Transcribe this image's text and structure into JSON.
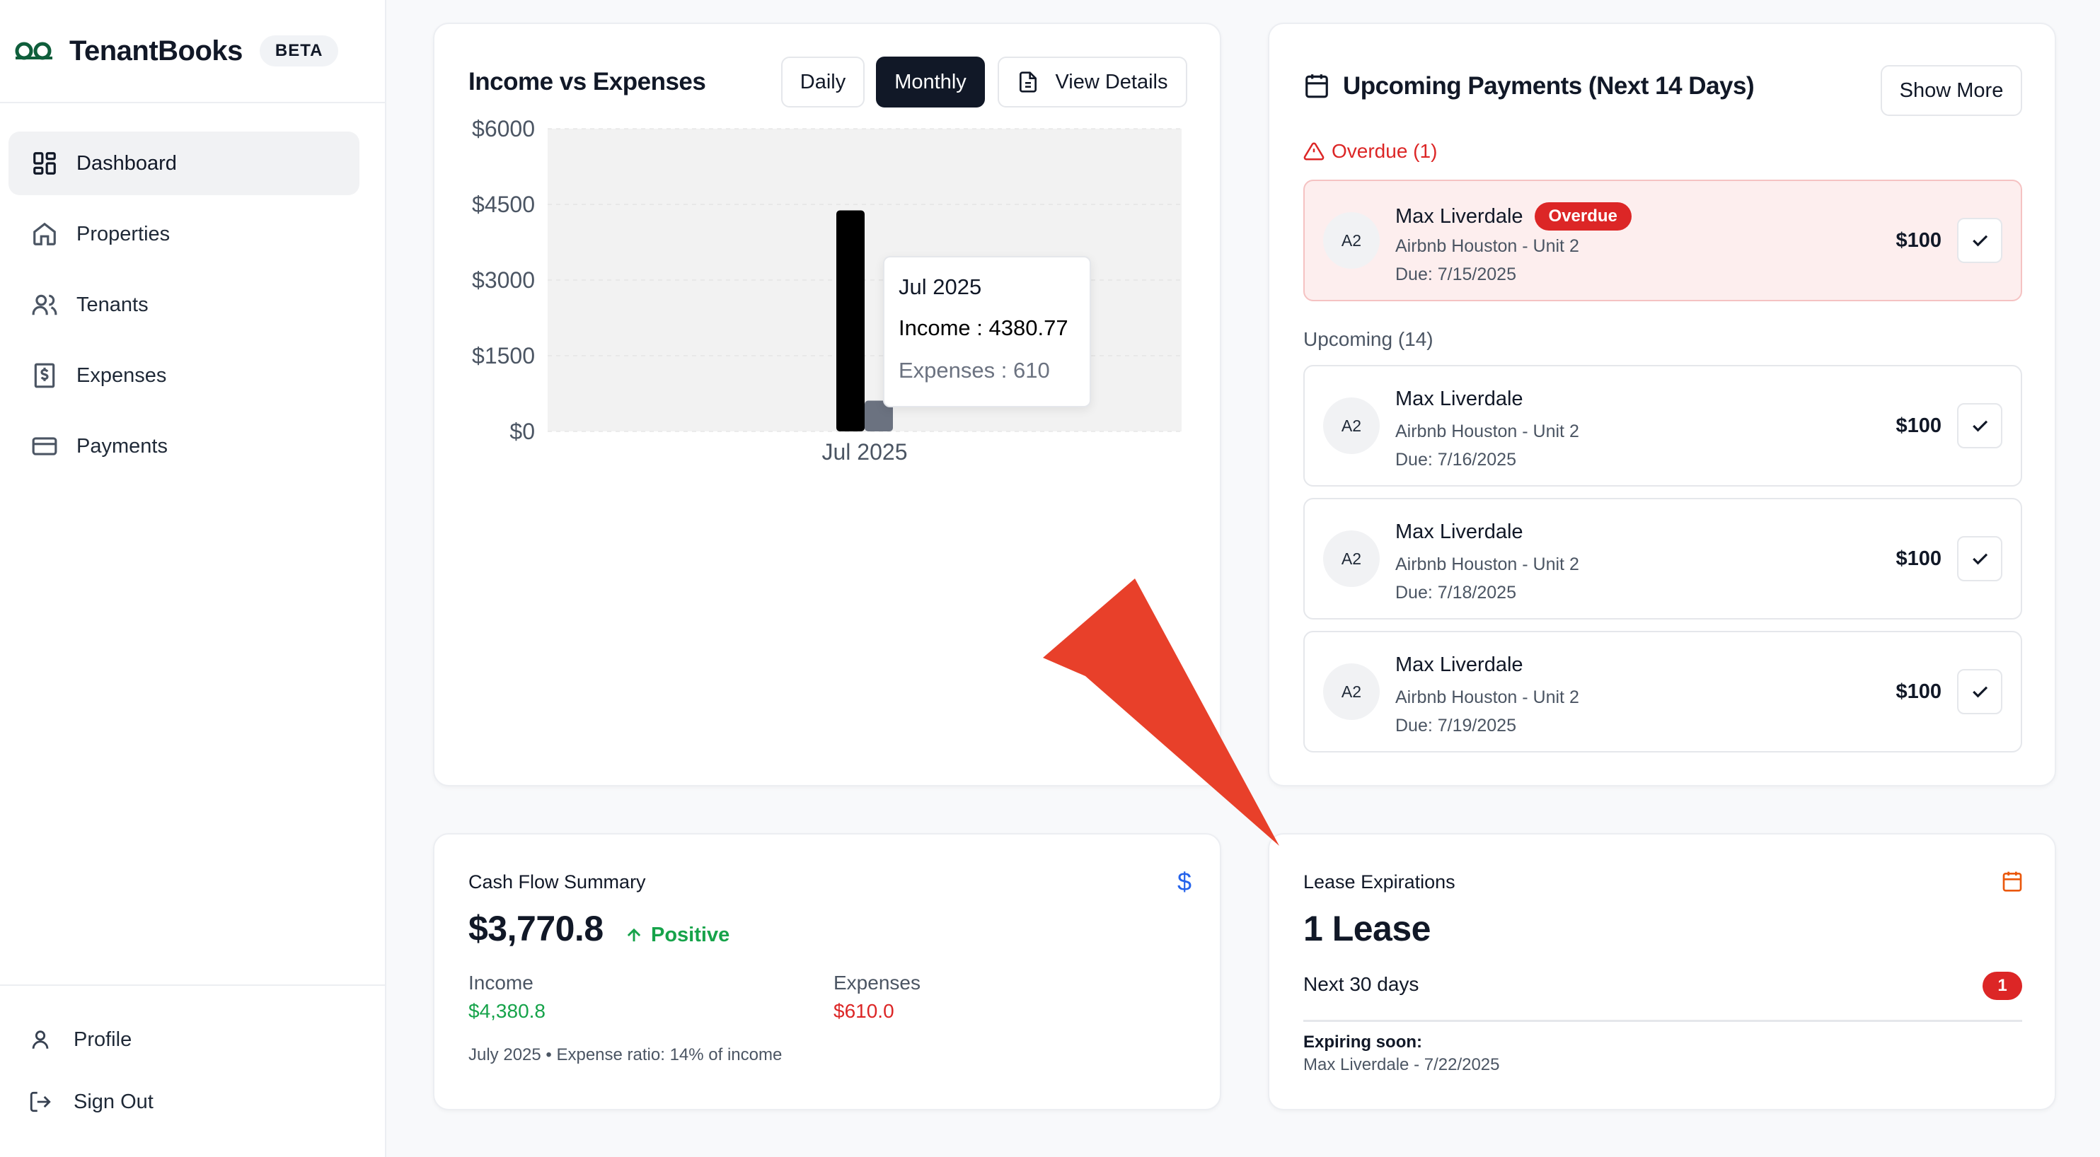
{
  "brand": {
    "name": "TenantBooks",
    "badge": "BETA"
  },
  "sidebar": {
    "items": [
      {
        "label": "Dashboard",
        "icon": "dashboard-icon",
        "active": true
      },
      {
        "label": "Properties",
        "icon": "home-icon"
      },
      {
        "label": "Tenants",
        "icon": "users-icon"
      },
      {
        "label": "Expenses",
        "icon": "receipt-icon"
      },
      {
        "label": "Payments",
        "icon": "credit-card-icon"
      }
    ],
    "bottom": [
      {
        "label": "Profile",
        "icon": "user-icon"
      },
      {
        "label": "Sign Out",
        "icon": "sign-out-icon"
      }
    ]
  },
  "income_card": {
    "title": "Income vs Expenses",
    "buttons": {
      "daily": "Daily",
      "monthly": "Monthly",
      "details": "View Details"
    },
    "tooltip": {
      "title": "Jul 2025",
      "income": "Income : 4380.77",
      "expenses": "Expenses : 610"
    }
  },
  "chart_data": {
    "type": "bar",
    "categories": [
      "Jul 2025"
    ],
    "series": [
      {
        "name": "Income",
        "values": [
          4380.77
        ],
        "color": "#000000"
      },
      {
        "name": "Expenses",
        "values": [
          610
        ],
        "color": "#6b7280"
      }
    ],
    "y_ticks": [
      "$0",
      "$1500",
      "$3000",
      "$4500",
      "$6000"
    ],
    "ylim": [
      0,
      6000
    ],
    "grid": true
  },
  "payments_card": {
    "title": "Upcoming Payments (Next 14 Days)",
    "show_more": "Show More",
    "overdue_label": "Overdue (1)",
    "upcoming_label": "Upcoming (14)",
    "overdue": [
      {
        "initials": "A2",
        "name": "Max Liverdale",
        "badge": "Overdue",
        "property": "Airbnb Houston - Unit 2",
        "due": "Due: 7/15/2025",
        "amount": "$100"
      }
    ],
    "upcoming": [
      {
        "initials": "A2",
        "name": "Max Liverdale",
        "property": "Airbnb Houston - Unit 2",
        "due": "Due: 7/16/2025",
        "amount": "$100"
      },
      {
        "initials": "A2",
        "name": "Max Liverdale",
        "property": "Airbnb Houston - Unit 2",
        "due": "Due: 7/18/2025",
        "amount": "$100"
      },
      {
        "initials": "A2",
        "name": "Max Liverdale",
        "property": "Airbnb Houston - Unit 2",
        "due": "Due: 7/19/2025",
        "amount": "$100"
      }
    ]
  },
  "cash_flow": {
    "title": "Cash Flow Summary",
    "value": "$3,770.8",
    "status": "Positive",
    "income_label": "Income",
    "income_value": "$4,380.8",
    "expenses_label": "Expenses",
    "expenses_value": "$610.0",
    "footnote": "July 2025 • Expense ratio: 14% of income"
  },
  "lease": {
    "title": "Lease Expirations",
    "value": "1 Lease",
    "window": "Next 30 days",
    "count": "1",
    "expiring_label": "Expiring soon:",
    "expiring_detail": "Max Liverdale - 7/22/2025"
  },
  "colors": {
    "accent_dark": "#111827",
    "danger": "#dc2626",
    "success": "#16a34a",
    "lease_icon": "#ea580c",
    "dollar_icon": "#2563eb",
    "arrow": "#e8402a"
  }
}
